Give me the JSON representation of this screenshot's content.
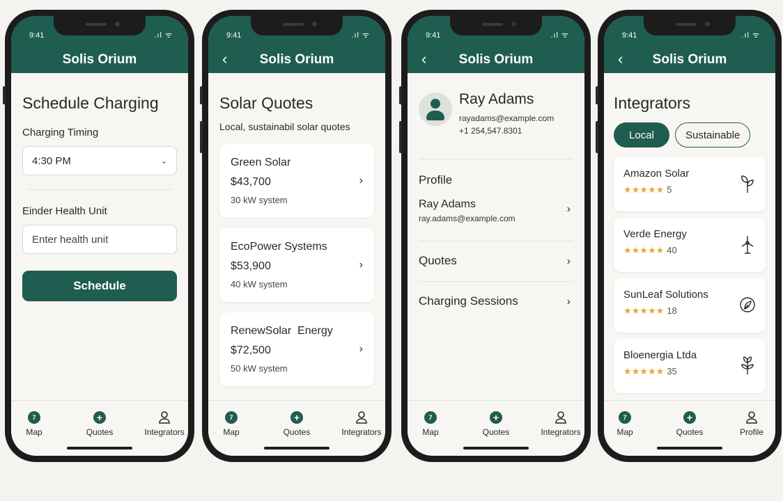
{
  "status": {
    "time": "9:41",
    "icons": "..ıl ᯤ"
  },
  "app": {
    "title": "Solis Orium",
    "back": "‹"
  },
  "screen1": {
    "heading": "Schedule Charging",
    "timing_label": "Charging Timing",
    "timing_value": "4:30 PM",
    "health_label": "Einder Health Unit",
    "health_placeholder": "Enter health unit",
    "schedule_button": "Schedule"
  },
  "screen2": {
    "heading": "Solar Quotes",
    "subheading": "Local, sustainabil solar quotes",
    "quotes": [
      {
        "name": "Green Solar",
        "price": "$43,700",
        "size": "30 kW system"
      },
      {
        "name": "EcoPower Systems",
        "price": "$53,900",
        "size": "40 kW system"
      },
      {
        "name": "RenewSolar  Energy",
        "price": "$72,500",
        "size": "50 kW system"
      }
    ]
  },
  "screen3": {
    "name": "Ray Adams",
    "email": "rayadams@example.com",
    "phone": "+1 254,547.8301",
    "profile_label": "Profile",
    "profile_name": "Ray Adams",
    "profile_email": "ray.adams@example.com",
    "quotes_label": "Quotes",
    "sessions_label": "Charging Sessions"
  },
  "screen4": {
    "heading": "Integrators",
    "filters": [
      "Local",
      "Sustainable"
    ],
    "integrators": [
      {
        "name": "Amazon Solar",
        "stars": "★★★★★",
        "count": "5",
        "icon": "sprout-icon"
      },
      {
        "name": "Verde Energy",
        "stars": "★★★★★",
        "count": "40",
        "icon": "wind-turbine-icon"
      },
      {
        "name": "SunLeaf Solutions",
        "stars": "★★★★★",
        "count": "18",
        "icon": "leaf-circle-icon"
      },
      {
        "name": "Bloenergia Ltda",
        "stars": "★★★★★",
        "count": "35",
        "icon": "plant-icon"
      }
    ]
  },
  "tabs": {
    "map": "Map",
    "map_badge": "7",
    "quotes": "Quotes",
    "integrators": "Integrators",
    "profile": "Profile"
  },
  "colors": {
    "brand": "#1f5d50",
    "star": "#e2a93a",
    "background": "#f4f3ef"
  }
}
